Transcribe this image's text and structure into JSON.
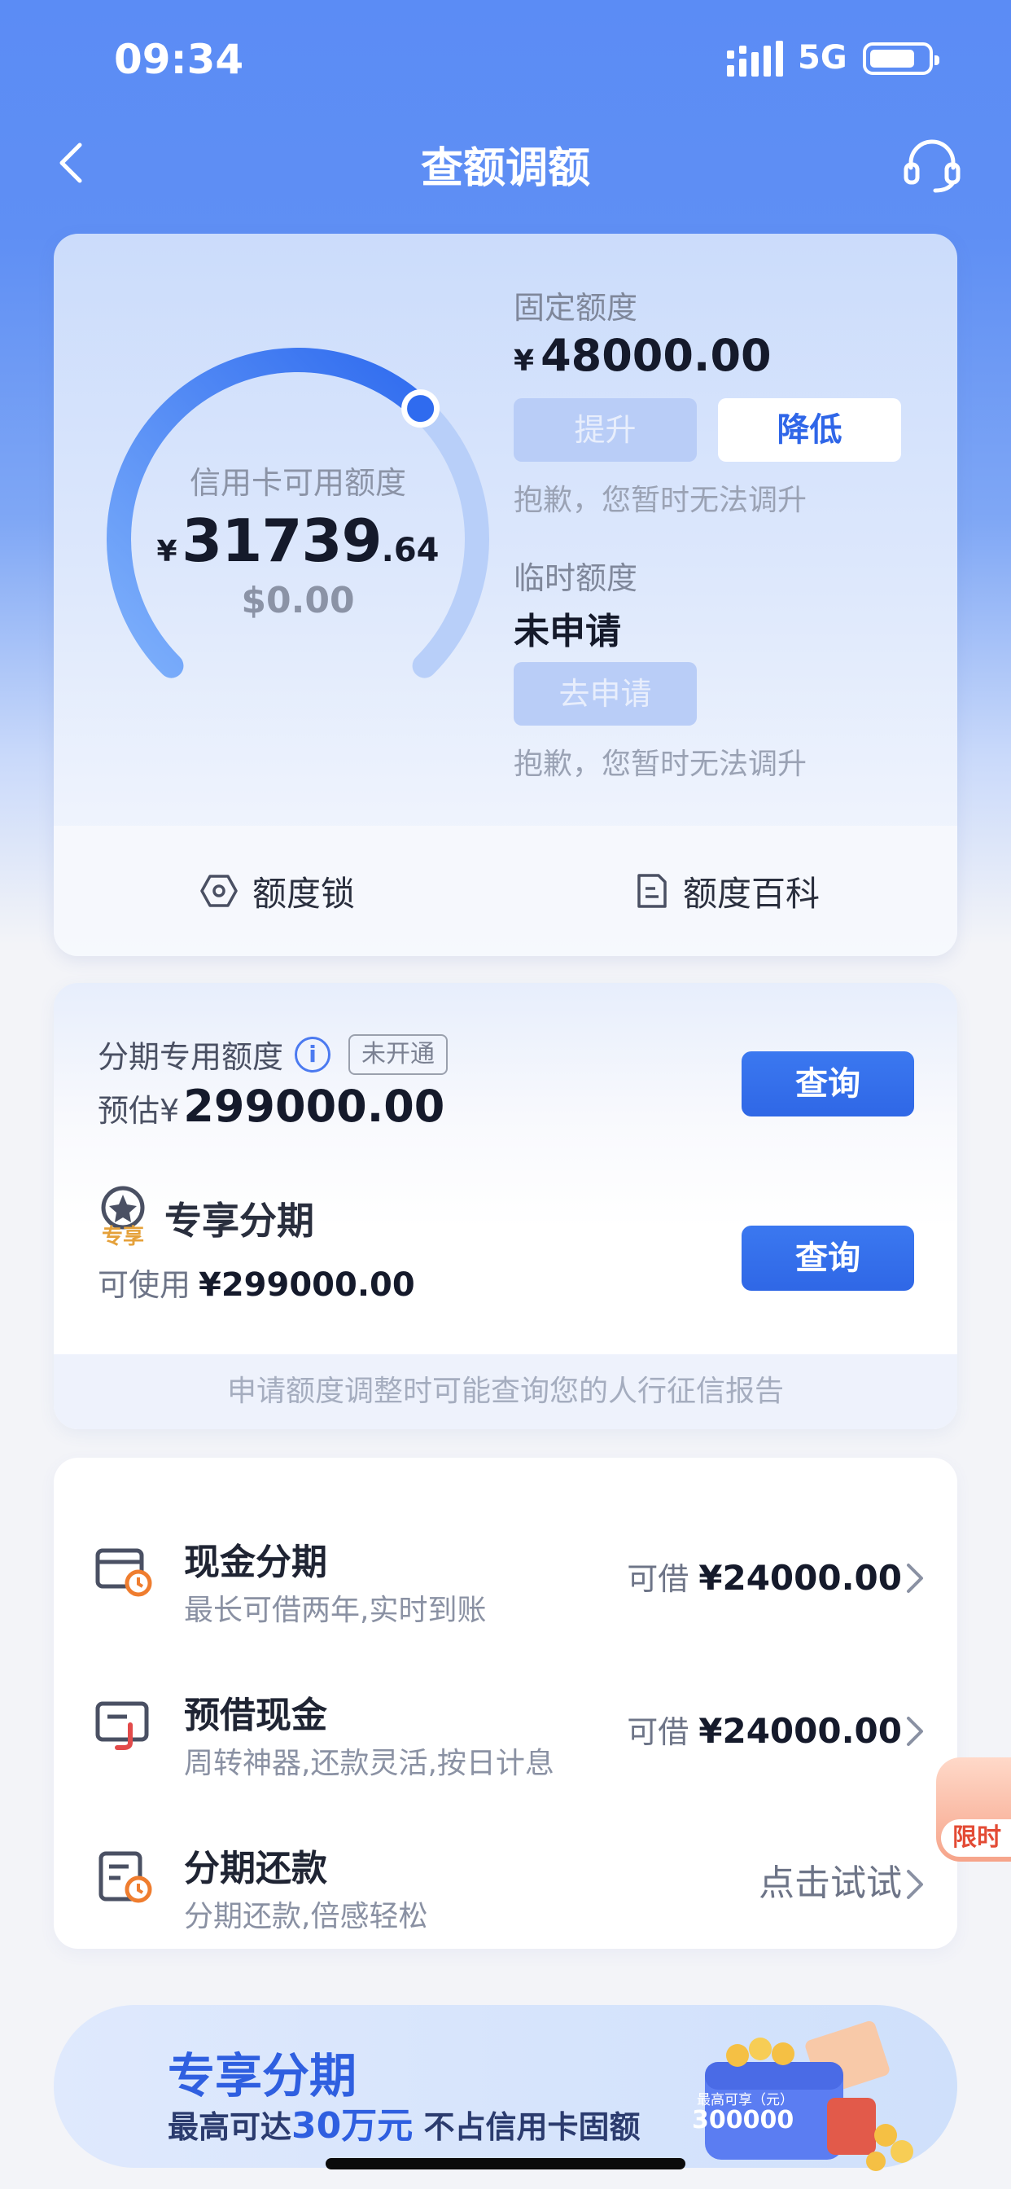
{
  "status_bar": {
    "time": "09:34",
    "network": "5G"
  },
  "nav": {
    "title": "查额调额",
    "back_icon": "chevron-left-icon",
    "service_icon": "headset-icon"
  },
  "colors": {
    "primary": "#2f67e6",
    "header": "#5b8cf5",
    "gauge_arc": "#4f8bf7",
    "gauge_track": "#b8cff9"
  },
  "credit": {
    "available_label": "信用卡可用额度",
    "currency": "¥",
    "available_int": "31739",
    "available_dec": ".64",
    "usd_available": "$0.00",
    "available_ratio_of_fixed": 0.66
  },
  "fixed": {
    "label": "固定额度",
    "currency": "¥",
    "amount": "48000.00",
    "raise_button": "提升",
    "lower_button": "降低",
    "note": "抱歉，您暂时无法调升"
  },
  "temporary": {
    "label": "临时额度",
    "status": "未申请",
    "apply_button": "去申请",
    "note": "抱歉，您暂时无法调升"
  },
  "card1_footer": {
    "lock_label": "额度锁",
    "wiki_label": "额度百科"
  },
  "installment": {
    "label": "分期专用额度",
    "tag": "未开通",
    "prefix": "预估¥",
    "amount": "299000.00",
    "query_button": "查询"
  },
  "exclusive": {
    "badge": "专享",
    "title": "专享分期",
    "available_label": "可使用",
    "available_amount": "¥299000.00",
    "query_button": "查询"
  },
  "credit_report_note": "申请额度调整时可能查询您的人行征信报告",
  "services": [
    {
      "title": "现金分期",
      "subtitle": "最长可借两年,实时到账",
      "right_label": "可借",
      "right_value": "¥24000.00",
      "icon": "cash-installment-icon"
    },
    {
      "title": "预借现金",
      "subtitle": "周转神器,还款灵活,按日计息",
      "right_label": "可借",
      "right_value": "¥24000.00",
      "icon": "cash-advance-icon"
    },
    {
      "title": "分期还款",
      "subtitle": "分期还款,倍感轻松",
      "right_label": "点击试试",
      "right_value": "",
      "icon": "installment-repay-icon"
    }
  ],
  "float_tab": {
    "label": "限时"
  },
  "banner": {
    "title": "专享分期",
    "subtitle_pre": "最高可达",
    "subtitle_highlight": "30万元",
    "subtitle_post": " 不占信用卡固额",
    "wallet_label": "最高可享（元）",
    "wallet_amount": "300000"
  }
}
